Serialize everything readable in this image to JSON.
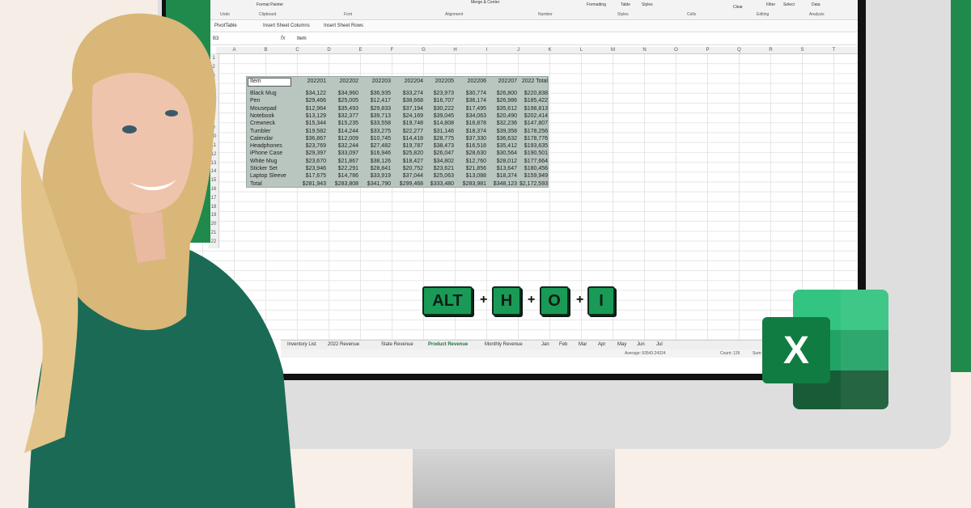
{
  "ribbon": {
    "groups": [
      "Undo",
      "Clipboard",
      "Font",
      "Alignment",
      "Number",
      "Styles",
      "Cells",
      "Editing",
      "Analysis"
    ],
    "items": [
      "Format Painter",
      "Merge & Center",
      "Formatting",
      "Table",
      "Styles",
      "Clear",
      "Filter",
      "Select",
      "Data"
    ]
  },
  "toolbar2": {
    "pivot": "PivotTable",
    "insert_cols": "Insert Sheet Columns",
    "insert_rows": "Insert Sheet Rows"
  },
  "formula_bar": {
    "name_box": "B3",
    "fx": "fx",
    "value": "Item"
  },
  "columns": [
    "A",
    "B",
    "C",
    "D",
    "E",
    "F",
    "G",
    "H",
    "I",
    "J",
    "K",
    "L",
    "M",
    "N",
    "O",
    "P",
    "Q",
    "R",
    "S",
    "T"
  ],
  "rows": [
    "1",
    "2",
    "3",
    "4",
    "5",
    "6",
    "7",
    "8",
    "9",
    "10",
    "11",
    "12",
    "13",
    "14",
    "15",
    "16",
    "17",
    "18",
    "19",
    "20",
    "21",
    "22"
  ],
  "table": {
    "header": [
      "Item",
      "202201",
      "202202",
      "202203",
      "202204",
      "202205",
      "202206",
      "202207",
      "2022 Total"
    ],
    "rows": [
      [
        "Black Mug",
        "$34,122",
        "$34,960",
        "$36,935",
        "$33,274",
        "$23,973",
        "$30,774",
        "$26,800",
        "$220,838"
      ],
      [
        "Pen",
        "$29,466",
        "$25,005",
        "$12,417",
        "$38,668",
        "$16,707",
        "$36,174",
        "$26,986",
        "$185,422"
      ],
      [
        "Mousepad",
        "$12,964",
        "$35,493",
        "$29,833",
        "$37,194",
        "$30,222",
        "$17,495",
        "$35,612",
        "$198,813"
      ],
      [
        "Notebook",
        "$13,129",
        "$32,377",
        "$39,713",
        "$24,169",
        "$39,045",
        "$34,063",
        "$20,490",
        "$202,414"
      ],
      [
        "Crewneck",
        "$15,344",
        "$15,235",
        "$33,558",
        "$19,748",
        "$14,808",
        "$16,878",
        "$32,236",
        "$147,807"
      ],
      [
        "Tumbler",
        "$19,582",
        "$14,244",
        "$33,275",
        "$22,277",
        "$31,146",
        "$18,374",
        "$39,358",
        "$178,256"
      ],
      [
        "Calendar",
        "$36,867",
        "$12,009",
        "$10,745",
        "$14,418",
        "$28,775",
        "$37,330",
        "$36,632",
        "$178,776"
      ],
      [
        "Headphones",
        "$23,769",
        "$32,244",
        "$27,482",
        "$19,787",
        "$38,473",
        "$16,518",
        "$35,412",
        "$193,635"
      ],
      [
        "iPhone Case",
        "$29,397",
        "$33,097",
        "$16,946",
        "$25,820",
        "$26,047",
        "$28,630",
        "$30,564",
        "$190,501"
      ],
      [
        "White Mug",
        "$23,670",
        "$21,867",
        "$38,126",
        "$18,427",
        "$34,802",
        "$12,760",
        "$28,012",
        "$177,664"
      ],
      [
        "Sticker Set",
        "$23,946",
        "$22,291",
        "$28,841",
        "$20,752",
        "$23,621",
        "$21,856",
        "$13,647",
        "$180,456"
      ],
      [
        "Laptop Sleeve",
        "$17,675",
        "$14,786",
        "$33,919",
        "$37,044",
        "$25,063",
        "$13,088",
        "$18,374",
        "$159,949"
      ],
      [
        "Total",
        "$281,943",
        "$283,808",
        "$341,790",
        "$299,468",
        "$333,480",
        "$283,981",
        "$348,123",
        "$2,172,593"
      ]
    ]
  },
  "sheet_tabs": [
    "Inventory List",
    "2022 Revenue",
    "State Revenue",
    "Product Revenue",
    "Monthly Revenue",
    "Jan",
    "Feb",
    "Mar",
    "Apr",
    "May",
    "Jun",
    "Jul"
  ],
  "active_tab": "Product Revenue",
  "status": {
    "average": "Average: 93543.24324",
    "count": "Count: 126",
    "sum": "Sum: 92335865"
  },
  "shortcut": {
    "keys": [
      "ALT",
      "H",
      "O",
      "I"
    ],
    "separator": "+"
  },
  "logo": {
    "letter": "X"
  },
  "colors": {
    "excel_green": "#107c41",
    "table_fill": "#b9c6c0",
    "key_green": "#1a9a57",
    "bg_green": "#1f8a4c"
  }
}
